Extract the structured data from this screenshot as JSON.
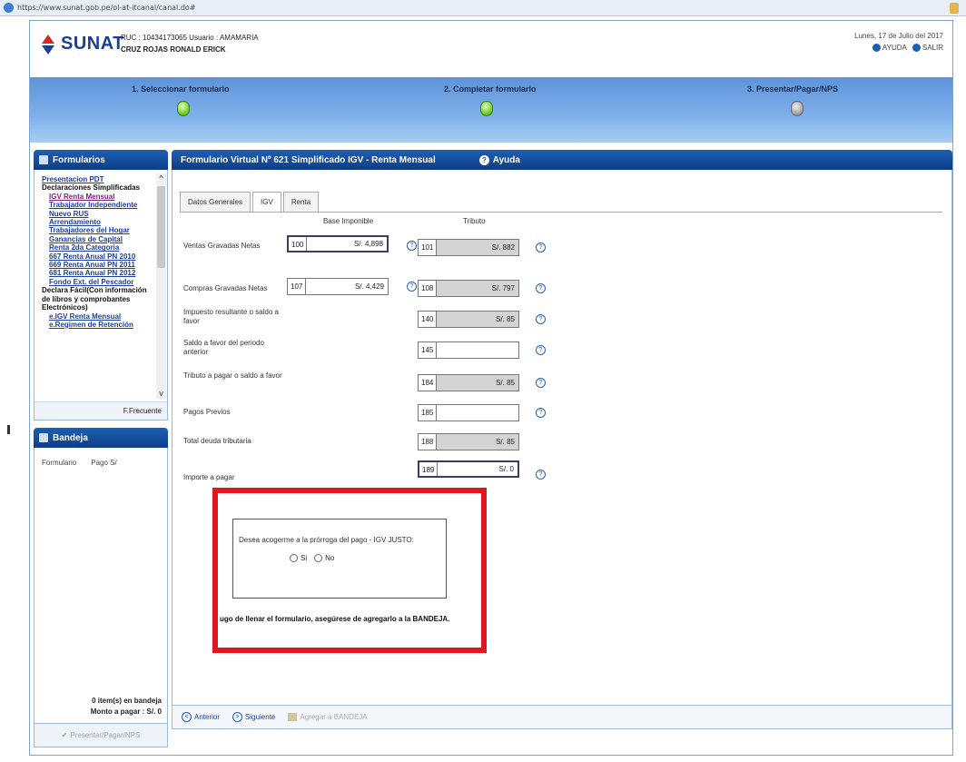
{
  "browser": {
    "url": "https://www.sunat.gob.pe/ol-at-itcanal/canal.do#"
  },
  "header": {
    "brand": "SUNAT",
    "ruc_line": "RUC : 10434173065  Usuario : AMAMARIA",
    "name_line": "CRUZ ROJAS RONALD ERICK",
    "date": "Lunes, 17 de Julio del 2017",
    "help_label": "AYUDA",
    "exit_label": "SALIR"
  },
  "steps": [
    {
      "label": "1. Seleccionar formulario",
      "state": "green"
    },
    {
      "label": "2. Completar formulario",
      "state": "green"
    },
    {
      "label": "3. Presentar/Pagar/NPS",
      "state": "grey"
    }
  ],
  "formularios": {
    "title": "Formularios",
    "items": [
      {
        "text": "Presentacion PDT",
        "kind": "link"
      },
      {
        "text": "Declaraciones Simplificadas",
        "kind": "section"
      },
      {
        "text": "IGV Renta Mensual",
        "kind": "link-selected"
      },
      {
        "text": "Trabajador Independiente",
        "kind": "link"
      },
      {
        "text": "Nuevo RUS",
        "kind": "link"
      },
      {
        "text": "Arrendamiento",
        "kind": "link"
      },
      {
        "text": "Trabajadores del Hogar",
        "kind": "link"
      },
      {
        "text": "Ganancias de Capital",
        "kind": "link"
      },
      {
        "text": "Renta 2da Categoria",
        "kind": "link"
      },
      {
        "text": "667 Renta Anual PN 2010",
        "kind": "link"
      },
      {
        "text": "669 Renta Anual PN 2011",
        "kind": "link"
      },
      {
        "text": "681 Renta Anual PN 2012",
        "kind": "link"
      },
      {
        "text": "Fondo Ext. del Pescador",
        "kind": "link"
      },
      {
        "text": "Declara Fácil(Con información de libros y comprobantes Electrónicos)",
        "kind": "section"
      },
      {
        "text": "e.IGV Renta Mensual",
        "kind": "link-sub"
      },
      {
        "text": "e.Regimen de Retención",
        "kind": "link-sub"
      }
    ],
    "footer": "F.Frecuente"
  },
  "bandeja": {
    "title": "Bandeja",
    "col_formulario": "Formulario",
    "col_pago": "Pago S/",
    "items_text": "0 item(s) en bandeja",
    "monto_text": "Monto a pagar : S/. 0",
    "presentar_label": "Presentar/Pagar/NPS"
  },
  "main": {
    "title": "Formulario Virtual Nº 621 Simplificado IGV - Renta Mensual",
    "help": "Ayuda",
    "tabs": [
      "Datos Generales",
      "IGV",
      "Renta"
    ],
    "col_base": "Base Imponible",
    "col_tributo": "Tributo",
    "rows": [
      {
        "label": "Ventas Gravadas Netas",
        "base_code": "100",
        "base_value": "S/. 4,898",
        "trib_code": "101",
        "trib_value": "S/. 882"
      },
      {
        "label": "Compras Gravadas Netas",
        "base_code": "107",
        "base_value": "S/. 4,429",
        "trib_code": "108",
        "trib_value": "S/. 797"
      },
      {
        "label": "Impuesto resultante o saldo a favor",
        "trib_code": "140",
        "trib_value": "S/. 85"
      },
      {
        "label": "Saldo a favor del periodo anterior",
        "trib_code": "145",
        "trib_value": ""
      },
      {
        "label": "Tributo a pagar o saldo a favor",
        "trib_code": "184",
        "trib_value": "S/. 85"
      },
      {
        "label": "Pagos Previos",
        "trib_code": "185",
        "trib_value": ""
      },
      {
        "label": "Total deuda tributaria",
        "trib_code": "188",
        "trib_value": "S/. 85"
      },
      {
        "label": "Importe a pagar",
        "trib_code": "189",
        "trib_value": "S/. 0"
      }
    ],
    "prorroga_question": "Desea acogerme a la prórroga del pago - IGV JUSTO:",
    "opt_si": "Si",
    "opt_no": "No",
    "note": "ugo de llenar el formulario, asegúrese de agregarlo a la BANDEJA.",
    "btn_anterior": "Anterior",
    "btn_siguiente": "Siguiente",
    "btn_agregar": "Agregar a BANDEJA"
  },
  "colors": {
    "highlight": "#e3141e",
    "panel_head": "#1d5fb4",
    "step_band": "#7fb0ea"
  }
}
